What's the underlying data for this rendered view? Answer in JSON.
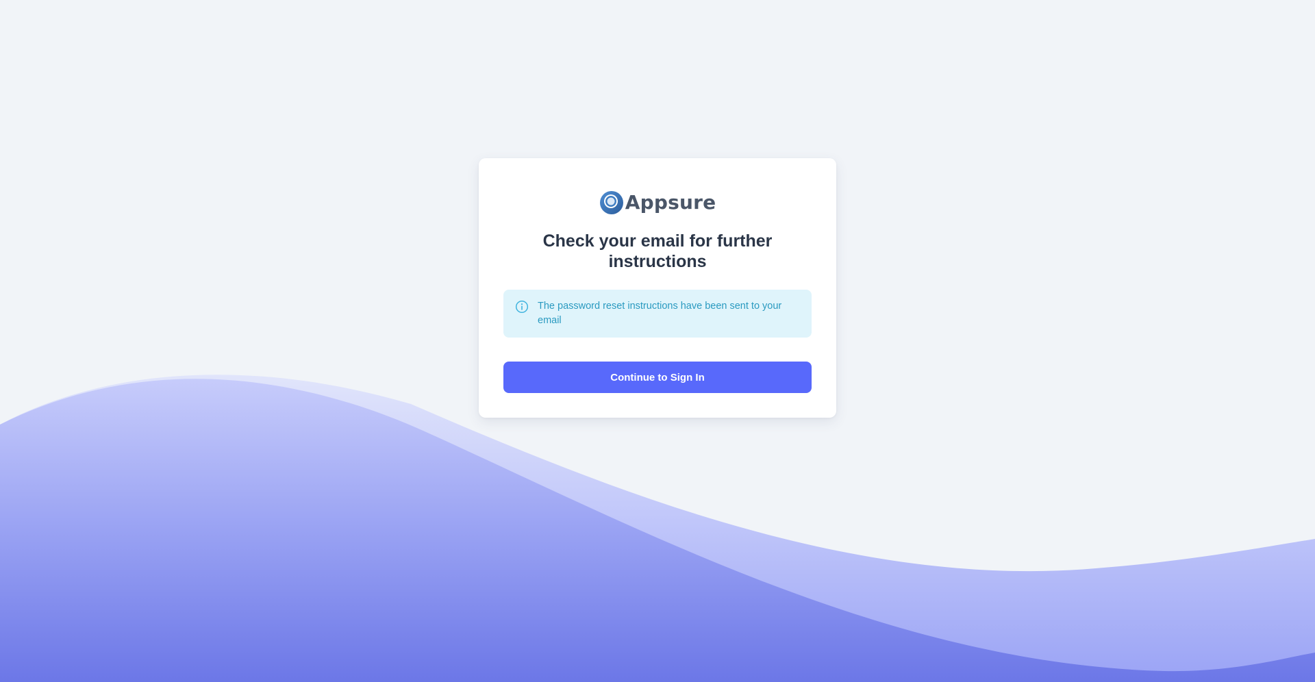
{
  "brand": {
    "name": "Appsure",
    "logo_icon": "appsure-logo-icon"
  },
  "card": {
    "heading": "Check your email for further instructions",
    "alert": {
      "icon": "info-icon",
      "message": "The password reset instructions have been sent to your email"
    },
    "continue_button_label": "Continue to Sign In"
  },
  "colors": {
    "page_background": "#f1f4f8",
    "primary": "#5869fb",
    "alert_background": "#dff4fb",
    "alert_text": "#2a9ac0",
    "heading": "#2a3547",
    "logo_text": "#4a5668",
    "wave_light": "#d9defa",
    "wave_dark": "#6f7be9"
  }
}
